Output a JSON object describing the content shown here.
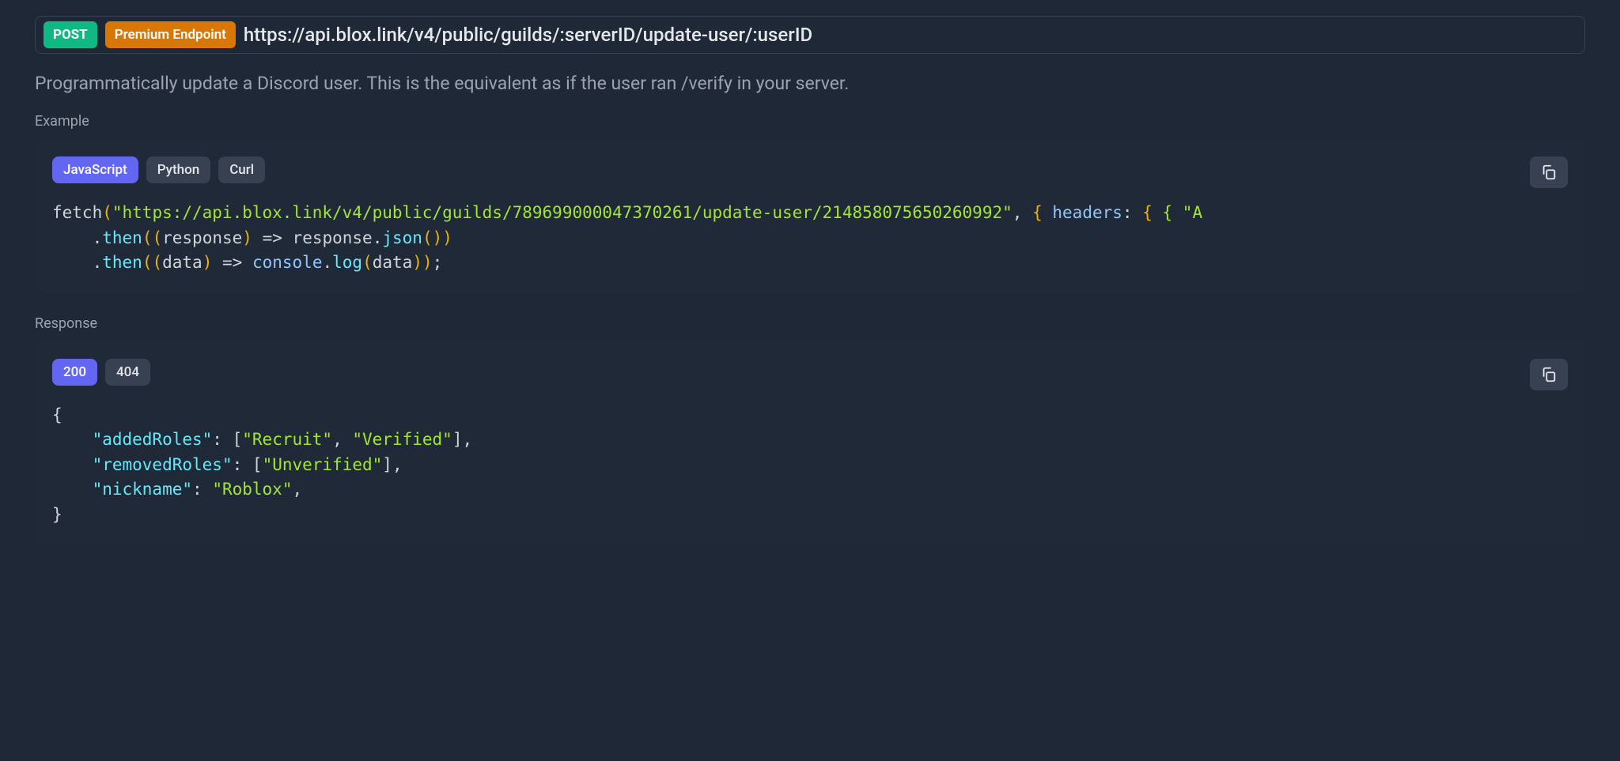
{
  "endpoint": {
    "method": "POST",
    "premium_label": "Premium Endpoint",
    "url": "https://api.blox.link/v4/public/guilds/:serverID/update-user/:userID"
  },
  "description": "Programmatically update a Discord user. This is the equivalent as if the user ran /verify in your server.",
  "example": {
    "label": "Example",
    "tabs": [
      "JavaScript",
      "Python",
      "Curl"
    ],
    "active_tab": 0,
    "code": {
      "url": "\"https://api.blox.link/v4/public/guilds/789699000047370261/update-user/214858075650260992\"",
      "fetch": "fetch",
      "then": "then",
      "response": "response",
      "json": "json",
      "data": "data",
      "console": "console",
      "log": "log",
      "headers": "headers",
      "arrow": "=>",
      "line3_rest": " { \"A",
      "open_brace": "{",
      "close_paren_paren": "()",
      "close_paren": ")",
      "open_paren": "(",
      "comma": ",",
      "colon": ":",
      "dot": ".",
      "semi": ";",
      "sp": " "
    }
  },
  "response": {
    "label": "Response",
    "tabs": [
      "200",
      "404"
    ],
    "active_tab": 0,
    "json": {
      "open": "{",
      "close": "}",
      "k_added": "\"addedRoles\"",
      "v_added_open": "[",
      "v_added_1": "\"Recruit\"",
      "v_added_2": "\"Verified\"",
      "v_added_close": "]",
      "k_removed": "\"removedRoles\"",
      "v_removed_open": "[",
      "v_removed_1": "\"Unverified\"",
      "v_removed_close": "]",
      "k_nick": "\"nickname\"",
      "v_nick": "\"Roblox\"",
      "colon": ":",
      "comma": ","
    }
  }
}
